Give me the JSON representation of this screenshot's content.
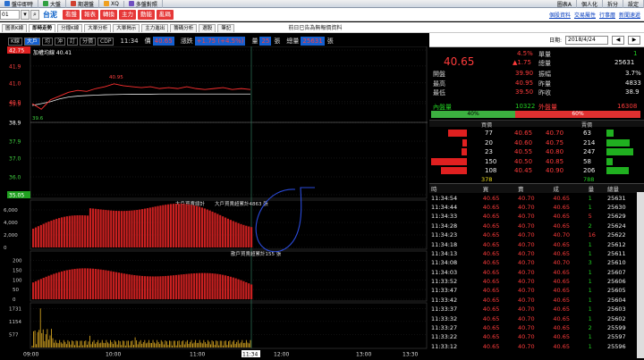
{
  "topbar": {
    "items": [
      "盤中即時",
      "大盤",
      "期選盤",
      "XQ",
      "多盤對照"
    ],
    "right_items": [
      "圖表A",
      "個人化",
      "拆分",
      "設定"
    ],
    "colors": {
      "bg": "#d8dee8"
    }
  },
  "toolbar": {
    "code_value": "01",
    "stock_name": "台泥",
    "red_buttons": [
      "看盤",
      "報表",
      "轉換",
      "主力",
      "動能",
      "亂碼"
    ],
    "right_links": [
      "個股資料",
      "交易屬性",
      "行事曆",
      "新聞速遞"
    ]
  },
  "tabs": {
    "items": [
      "圖表K線",
      "即時走勢",
      "分鐘K線",
      "大單分析",
      "大單揭示",
      "主力進出",
      "籌碼分析",
      "選股",
      "筆記"
    ],
    "active_index": 1,
    "notice": "前日已告為無報價資料"
  },
  "infobar": {
    "buttons": [
      "K線",
      "大戶",
      "均",
      "沖",
      "訂",
      "分價",
      "CDP"
    ],
    "active_index": 1,
    "time": "11:34",
    "price_label": "價",
    "price": "40.65",
    "change_label": "漲跌",
    "change": "+1.75 (+4.5%)",
    "vol_label": "量",
    "vol": "25",
    "vol_unit": "張",
    "total_label": "總量",
    "total": "25631",
    "total_unit": "張"
  },
  "chart_data": {
    "type": "line",
    "title": "",
    "price_label": "加權均線 40.41",
    "y_ticks": [
      "42.75",
      "41.9",
      "41.0",
      "40.0",
      "39.9",
      "38.9",
      "37.9",
      "37.0",
      "36.0",
      "35.05"
    ],
    "x_ticks": [
      "09:00",
      "10:00",
      "11:00",
      "11:34",
      "12:00",
      "13:00",
      "13:30"
    ],
    "peak_label": "40.95",
    "low_label": "39.6",
    "series_price": [
      39.9,
      39.6,
      40.1,
      40.3,
      40.5,
      40.6,
      40.55,
      40.7,
      40.8,
      40.95,
      40.85,
      40.8,
      40.75,
      40.8,
      40.7,
      40.75,
      40.7,
      40.8,
      40.7,
      40.65,
      40.7,
      40.75,
      40.65,
      40.7,
      40.65
    ],
    "series_avg": [
      39.8,
      39.9,
      40.0,
      40.15,
      40.25,
      40.3,
      40.33,
      40.35,
      40.37,
      40.38,
      40.39,
      40.4,
      40.4,
      40.4,
      40.41,
      40.41,
      40.41,
      40.41,
      40.41,
      40.41,
      40.41,
      40.41,
      40.41,
      40.41,
      40.41
    ],
    "ylim": [
      35.05,
      42.75
    ],
    "panel2_title": "大戶買賣總計",
    "panel2_label": "大戶買賣超累計4863 張",
    "panel2_ticks": [
      "6,000",
      "4,000",
      "2,000",
      "0"
    ],
    "panel3_label": "散戶買賣超累計155 張",
    "panel3_ticks": [
      "200",
      "150",
      "100",
      "50",
      "0"
    ],
    "panel4_ticks": [
      "1731",
      "1154",
      "577"
    ]
  },
  "quote": {
    "price": "40.65",
    "pct": "4.5%",
    "change": "▲1.75",
    "vol_label": "單量",
    "vol": "1",
    "total_label": "總量",
    "total": "25631",
    "rows": [
      {
        "l": "開盤",
        "v": "39.90",
        "l2": "振幅",
        "v2": "3.7%"
      },
      {
        "l": "最高",
        "v": "40.95",
        "l2": "昨量",
        "v2": "4833"
      },
      {
        "l": "最低",
        "v": "39.50",
        "l2": "昨收",
        "v2": "38.9"
      }
    ],
    "in_label": "內盤量",
    "in_val": "10322",
    "out_label": "外盤量",
    "out_val": "16308",
    "in_pct": "40%",
    "out_pct": "60%",
    "buy_header": "買價",
    "sell_header": "賣價",
    "book": [
      {
        "bq": "77",
        "bp": "40.65",
        "sp": "40.70",
        "sq": "63"
      },
      {
        "bq": "20",
        "bp": "40.60",
        "sp": "40.75",
        "sq": "214"
      },
      {
        "bq": "23",
        "bp": "40.55",
        "sp": "40.80",
        "sq": "247"
      },
      {
        "bq": "150",
        "bp": "40.50",
        "sp": "40.85",
        "sq": "58"
      },
      {
        "bq": "108",
        "bp": "40.45",
        "sp": "40.90",
        "sq": "206"
      }
    ],
    "book_total_buy": "378",
    "book_total_sell": "788"
  },
  "date_bar": {
    "label": "日期:",
    "value": "2018/4/24"
  },
  "trades": {
    "headers": [
      "時",
      "買",
      "賣",
      "成",
      "量",
      "總量"
    ],
    "rows": [
      [
        "11:34:54",
        "40.65",
        "40.70",
        "40.65",
        "1",
        "25631"
      ],
      [
        "11:34:44",
        "40.65",
        "40.70",
        "40.65",
        "1",
        "25630"
      ],
      [
        "11:34:33",
        "40.65",
        "40.70",
        "40.65",
        "5",
        "25629"
      ],
      [
        "11:34:28",
        "40.65",
        "40.70",
        "40.65",
        "2",
        "25624"
      ],
      [
        "11:34:23",
        "40.65",
        "40.70",
        "40.70",
        "16",
        "25622"
      ],
      [
        "11:34:18",
        "40.65",
        "40.70",
        "40.65",
        "1",
        "25612"
      ],
      [
        "11:34:13",
        "40.65",
        "40.70",
        "40.65",
        "1",
        "25611"
      ],
      [
        "11:34:08",
        "40.65",
        "40.70",
        "40.70",
        "3",
        "25610"
      ],
      [
        "11:34:03",
        "40.65",
        "40.70",
        "40.65",
        "1",
        "25607"
      ],
      [
        "11:33:52",
        "40.65",
        "40.70",
        "40.65",
        "1",
        "25606"
      ],
      [
        "11:33:47",
        "40.65",
        "40.70",
        "40.65",
        "1",
        "25605"
      ],
      [
        "11:33:42",
        "40.65",
        "40.70",
        "40.65",
        "1",
        "25604"
      ],
      [
        "11:33:37",
        "40.65",
        "40.70",
        "40.65",
        "1",
        "25603"
      ],
      [
        "11:33:32",
        "40.65",
        "40.70",
        "40.65",
        "1",
        "25602"
      ],
      [
        "11:33:27",
        "40.65",
        "40.70",
        "40.65",
        "2",
        "25599"
      ],
      [
        "11:33:22",
        "40.65",
        "40.70",
        "40.65",
        "1",
        "25597"
      ],
      [
        "11:33:12",
        "40.65",
        "40.70",
        "40.65",
        "1",
        "25596"
      ]
    ]
  }
}
